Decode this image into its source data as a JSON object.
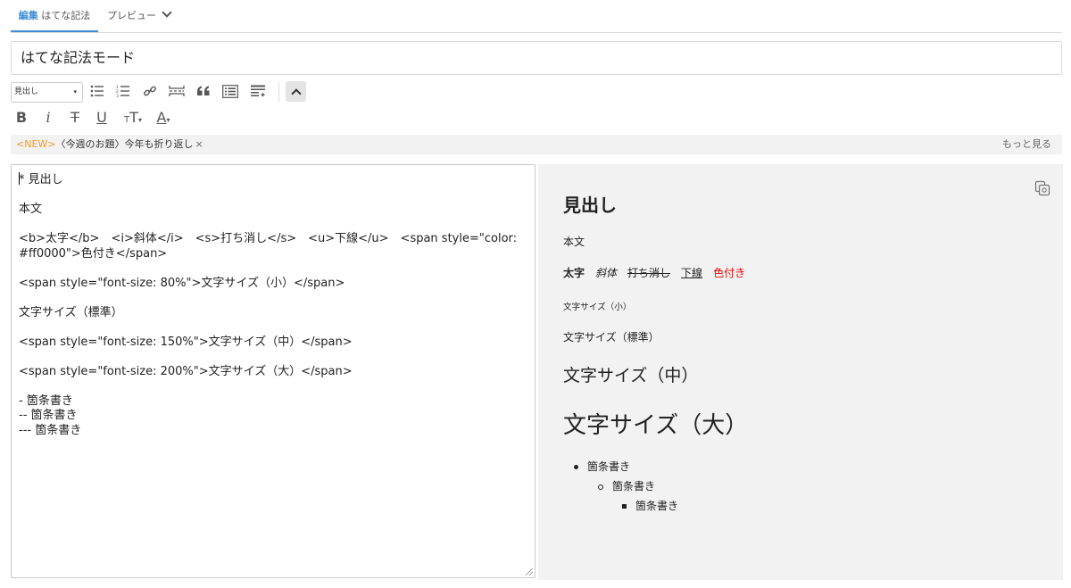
{
  "tabs": {
    "edit_strong": "編集",
    "edit_rest": "はてな記法",
    "preview": "プレビュー"
  },
  "title": "はてな記法モード",
  "toolbar": {
    "heading_select": "見出し"
  },
  "notice": {
    "new": "<NEW>",
    "topic": "〈今週のお題〉今年も折り返し",
    "close": "×",
    "more": "もっと見る"
  },
  "editor": {
    "text": "* 見出し\n\n本文\n\n<b>太字</b>　<i>斜体</i>　<s>打ち消し</s>　<u>下線</u>　<span style=\"color:\n#ff0000\">色付き</span>\n\n<span style=\"font-size: 80%\">文字サイズ（小）</span>\n\n文字サイズ（標準）\n\n<span style=\"font-size: 150%\">文字サイズ（中）</span>\n\n<span style=\"font-size: 200%\">文字サイズ（大）</span>\n\n- 箇条書き\n-- 箇条書き\n--- 箇条書き"
  },
  "preview": {
    "heading": "見出し",
    "body": "本文",
    "bold": "太字",
    "italic": "斜体",
    "strike": "打ち消し",
    "underline": "下線",
    "colored": "色付き",
    "colored_hex": "#ff0000",
    "size_small": "文字サイズ（小）",
    "size_normal": "文字サイズ（標準）",
    "size_medium": "文字サイズ（中）",
    "size_large": "文字サイズ（大）",
    "list": [
      "箇条書き",
      "箇条書き",
      "箇条書き"
    ]
  },
  "colors": {
    "accent": "#3d8fd6",
    "new_badge": "#f59a23",
    "preview_bg": "#f2f2f2"
  }
}
